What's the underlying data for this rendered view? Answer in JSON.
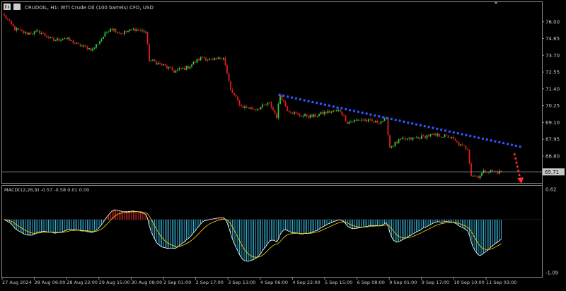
{
  "header": {
    "icon": "chart-menu-icon",
    "title": "CRUDOIL, H1:  WTI Crude Oil (100 barrels) CFD, USD"
  },
  "price_panel": {
    "y_ticks": [
      "76.00",
      "74.85",
      "73.70",
      "72.55",
      "71.40",
      "70.25",
      "69.10",
      "67.95",
      "66.80"
    ],
    "y_range": [
      65.0,
      77.2
    ],
    "current_price": "65.71",
    "current_price_value": 65.71
  },
  "macd_panel": {
    "label": "MACD(12,26,9) -0.57 -0.58 0.01 0.00",
    "y_ticks": [
      "0.62",
      "-1.09"
    ],
    "y_range": [
      -1.16,
      0.68
    ]
  },
  "x_labels": [
    "27 Aug 2024",
    "28 Aug 06:00",
    "28 Aug 22:00",
    "29 Aug 15:00",
    "30 Aug 08:00",
    "2 Sep 01:00",
    "2 Sep 17:00",
    "3 Sep 13:00",
    "4 Sep 06:00",
    "4 Sep 22:00",
    "5 Sep 15:00",
    "6 Sep 08:00",
    "9 Sep 01:00",
    "9 Sep 17:00",
    "10 Sep 10:00",
    "11 Sep 03:00"
  ],
  "colors": {
    "background": "#000000",
    "up_candle": "#2ecc40",
    "down_candle": "#e02020",
    "axis_text": "#c8c8c8",
    "trendline": "#3355ff",
    "arrow": "#ff3030",
    "macd_positive": "#cc2222",
    "macd_negative": "#33aacc",
    "macd_line": "#ffffff",
    "signal_line": "#ffd700"
  },
  "chart_data": [
    {
      "type": "candlestick",
      "title": "CRUDOIL, H1:  WTI Crude Oil (100 barrels) CFD, USD",
      "approx_close_path": [
        [
          0,
          76.4
        ],
        [
          6,
          75.5
        ],
        [
          12,
          75.2
        ],
        [
          20,
          75.3
        ],
        [
          28,
          74.7
        ],
        [
          34,
          74.9
        ],
        [
          42,
          74.4
        ],
        [
          50,
          74.1
        ],
        [
          56,
          75.0
        ],
        [
          60,
          75.6
        ],
        [
          66,
          75.2
        ],
        [
          74,
          75.5
        ],
        [
          80,
          75.3
        ],
        [
          82,
          73.4
        ],
        [
          90,
          73.0
        ],
        [
          96,
          72.6
        ],
        [
          104,
          72.9
        ],
        [
          112,
          73.6
        ],
        [
          118,
          73.3
        ],
        [
          124,
          73.6
        ],
        [
          128,
          71.3
        ],
        [
          134,
          70.2
        ],
        [
          142,
          70.0
        ],
        [
          150,
          70.4
        ],
        [
          154,
          69.5
        ],
        [
          156,
          71.0
        ],
        [
          160,
          70.0
        ],
        [
          166,
          69.6
        ],
        [
          174,
          69.5
        ],
        [
          182,
          69.8
        ],
        [
          190,
          69.9
        ],
        [
          194,
          69.1
        ],
        [
          202,
          69.3
        ],
        [
          210,
          69.1
        ],
        [
          216,
          69.3
        ],
        [
          218,
          67.4
        ],
        [
          224,
          67.9
        ],
        [
          232,
          68.0
        ],
        [
          240,
          68.2
        ],
        [
          246,
          68.2
        ],
        [
          252,
          68.1
        ],
        [
          258,
          67.5
        ],
        [
          262,
          67.3
        ],
        [
          264,
          65.5
        ],
        [
          268,
          65.4
        ],
        [
          272,
          65.8
        ],
        [
          278,
          65.7
        ]
      ],
      "trendline": {
        "start": [
          "4 Sep 06:00",
          71.0
        ],
        "end": [
          "after 11 Sep 03:00",
          67.4
        ]
      },
      "projection_arrow": {
        "direction": "down"
      },
      "current_price": 65.71,
      "ylim": [
        65.0,
        77.2
      ]
    },
    {
      "type": "macd",
      "label": "MACD(12,26,9) -0.57 -0.58 0.01 0.00",
      "params": [
        12,
        26,
        9
      ],
      "values": {
        "macd": -0.57,
        "signal": -0.58,
        "hist_a": 0.01,
        "hist_b": 0.0
      },
      "ylim": [
        -1.16,
        0.68
      ]
    }
  ]
}
